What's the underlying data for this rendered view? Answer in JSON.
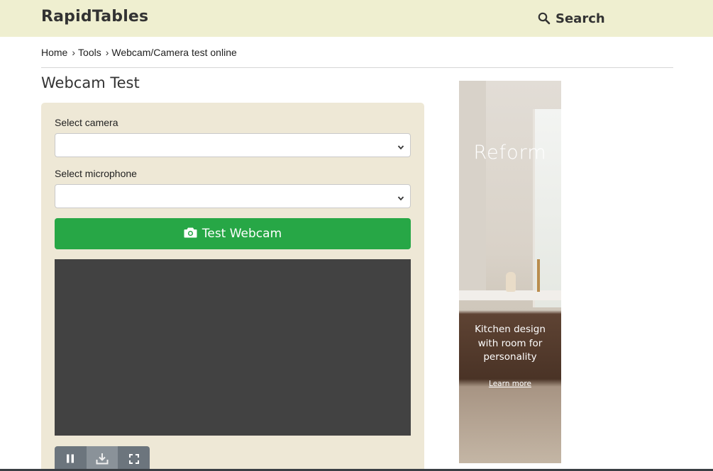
{
  "header": {
    "logo": "RapidTables",
    "search_label": "Search"
  },
  "breadcrumb": {
    "items": [
      "Home",
      "Tools",
      "Webcam/Camera test online"
    ],
    "separator": "›"
  },
  "page": {
    "title": "Webcam Test"
  },
  "form": {
    "camera_label": "Select camera",
    "camera_value": "",
    "microphone_label": "Select microphone",
    "microphone_value": "",
    "test_button_label": "Test Webcam"
  },
  "video_controls": {
    "icons": [
      "pause-icon",
      "download-icon",
      "fullscreen-icon"
    ]
  },
  "ad": {
    "brand": "Reform",
    "tagline": "Kitchen design with room for personality",
    "link": "Learn more"
  },
  "colors": {
    "header_bg": "#efefd0",
    "panel_bg": "#eee8d6",
    "accent_green": "#27a746",
    "video_bg": "#424242",
    "control_bg": "#6c757d"
  }
}
